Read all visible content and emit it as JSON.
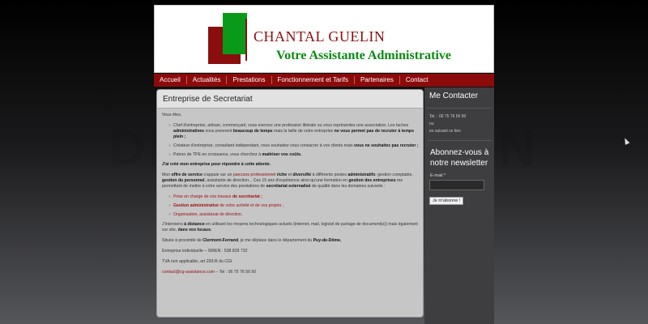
{
  "header": {
    "site_name": "CHANTAL GUELIN",
    "tagline": "Votre Assistante Administrative"
  },
  "nav": [
    "Accueil",
    "Actualités",
    "Prestations",
    "Fonctionnement et Tarifs",
    "Partenaires",
    "Contact"
  ],
  "main": {
    "title": "Entreprise de Secretariat",
    "intro": "Vous êtes,",
    "list1": [
      {
        "a": "Chef d'entreprise, artisan, commerçant, vous exercez une profession libérale ou vous représentez une association. Les taches ",
        "b": "administratives",
        "c": " vous prennent ",
        "d": "beaucoup de temps",
        "e": " mais la taille de votre entreprise ",
        "f": "ne vous permet pas de recruter à temps plein ;"
      },
      {
        "a": "Créateur d'entreprise, consultant indépendant, vous souhaitez vous consacrer à vos clients mais ",
        "b": "vous ne souhaitez pas recruter ;"
      },
      {
        "a": "Patron de TPE en croissance, vous cherchez à ",
        "b": "maitriser vos coûts."
      }
    ],
    "created": "J'ai créé  mon entreprise pour répondre à cette attente.",
    "offer": {
      "p1": "Mon ",
      "p2": "offre de service",
      "p3": " s'appuie sur un ",
      "p4": "parcours professionnel",
      "p5": " riche",
      "p6": " et ",
      "p7": "diversifié",
      "p8": " à différents postes ",
      "p9": "administratifs",
      "p10": ": gestion comptable, ",
      "p11": "gestion du personnel",
      "p12": ", assistante de direction... Ces 15 ans d'expérience ainsi qu'une formation en ",
      "p13": "gestion des entreprises",
      "p14": " me permettent de mettre à votre service des prestations de ",
      "p15": "secrétariat externalisé",
      "p16": " de qualité dans les domaines suivants :"
    },
    "list2": [
      {
        "a": "Prise en charge de vos travaux ",
        "b": "de secrétariat ;"
      },
      {
        "a": "Gestion administrative",
        "b": " de votre activité et de vos projets ;"
      },
      {
        "a": "Organisation, assistanat de direction.",
        "b": ""
      }
    ],
    "distance": {
      "a": "J'interviens ",
      "b": "à distance",
      "c": " en utilisant les moyens technologiques actuels (internet, mail, logiciel de partage de document(s)) mais également sur site, ",
      "d": "dans vos locaux."
    },
    "location": {
      "a": "Située à proximité de ",
      "b": "Clermont-Ferrand",
      "c": ", je me déplace dans le département du ",
      "d": "Puy-de-Dôme."
    },
    "siren": "Entreprise individuelle – SIREN : 538 828 732",
    "tva": "TVA non applicable, art 293-B du CGI",
    "contact_email": "contact@cg-assistance.com",
    "contact_tel": " – Tel : 06 75 76 56 50"
  },
  "sidebar": {
    "contact_title": "Me Contacter",
    "tel": "Tel. : 06 75 76 56 50",
    "ou": "ou",
    "link_text": "en suivant ce lien",
    "newsletter_title": "Abonnez-vous à notre newsletter",
    "email_label": "E-mail *",
    "subscribe_button": "Je m'abonne !"
  },
  "watermark": "DEMO VERSION"
}
